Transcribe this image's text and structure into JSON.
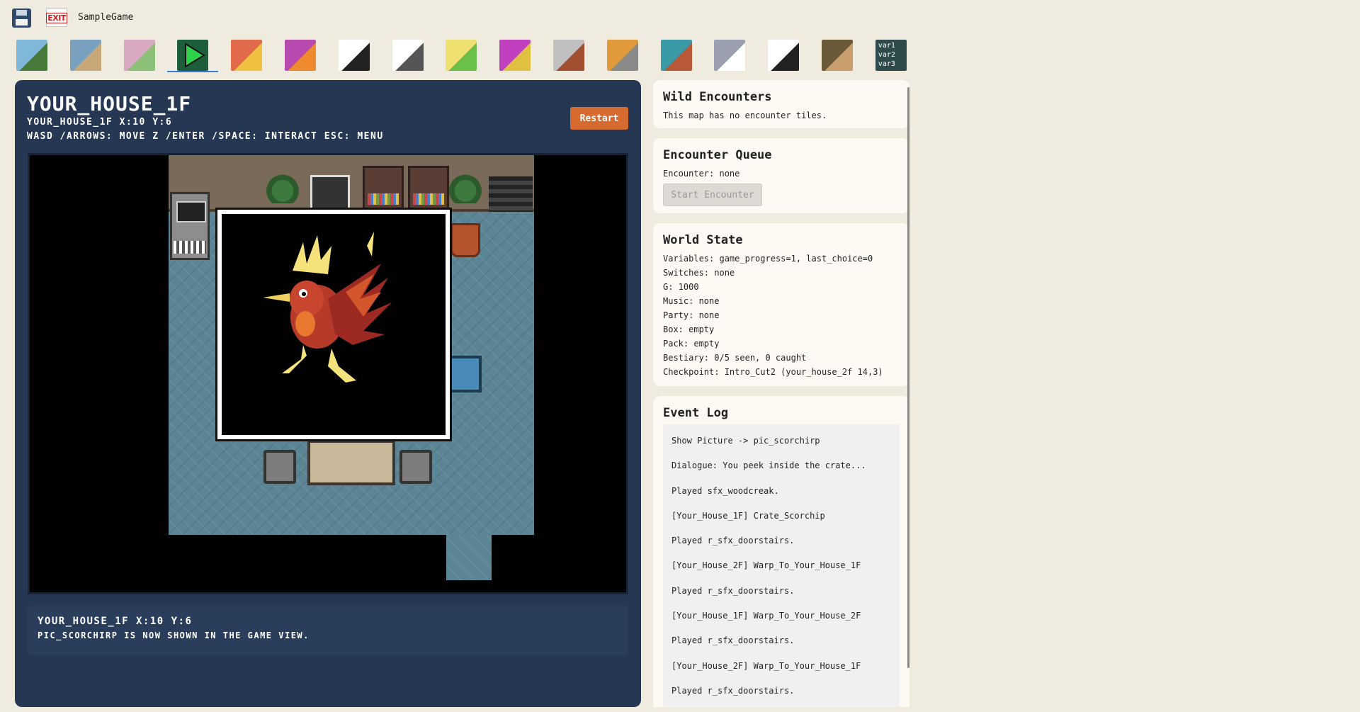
{
  "app": {
    "name": "SampleGame",
    "exit_label": "EXIT"
  },
  "toolbar": {
    "tools": [
      {
        "name": "map-editor-tool"
      },
      {
        "name": "tileset-tool"
      },
      {
        "name": "egg-tool"
      },
      {
        "name": "play-tool"
      },
      {
        "name": "battle-vs-tool"
      },
      {
        "name": "fire-skill-tool"
      },
      {
        "name": "movement-tool"
      },
      {
        "name": "dialogue-tool"
      },
      {
        "name": "potion-tool"
      },
      {
        "name": "creature-tool"
      },
      {
        "name": "characters-tool"
      },
      {
        "name": "settings-tools-tool"
      },
      {
        "name": "shop-tool"
      },
      {
        "name": "script-tool"
      },
      {
        "name": "music-tool"
      },
      {
        "name": "pictures-tool"
      },
      {
        "name": "variables-tool"
      }
    ],
    "active_index": 3,
    "variables_label": "var1 var2 var3"
  },
  "game": {
    "map_title": "YOUR_HOUSE_1F",
    "map_sub": "YOUR_HOUSE_1F   X:10   Y:6",
    "controls_help": "WASD /ARROWS: MOVE   Z /ENTER /SPACE: INTERACT   ESC: MENU",
    "restart_label": "Restart",
    "status_line1": "YOUR_HOUSE_1F   X:10   Y:6",
    "status_line2": "PIC_SCORCHIRP IS NOW SHOWN IN THE GAME VIEW."
  },
  "wild_encounters": {
    "title": "Wild Encounters",
    "text": "This map has no encounter tiles."
  },
  "encounter_queue": {
    "title": "Encounter Queue",
    "text": "Encounter: none",
    "button_label": "Start Encounter"
  },
  "world_state": {
    "title": "World State",
    "lines": [
      "Variables: game_progress=1, last_choice=0",
      "Switches: none",
      "G: 1000",
      "Music: none",
      "Party: none",
      "Box: empty",
      "Pack: empty",
      "Bestiary: 0/5 seen, 0 caught",
      "Checkpoint: Intro_Cut2 (your_house_2f 14,3)"
    ]
  },
  "event_log": {
    "title": "Event Log",
    "entries": [
      "Show Picture -> pic_scorchirp",
      "Dialogue: You peek inside the crate...",
      "Played sfx_woodcreak.",
      "[Your_House_1F] Crate_Scorchip",
      "Played r_sfx_doorstairs.",
      "[Your_House_2F] Warp_To_Your_House_1F",
      "Played r_sfx_doorstairs.",
      "[Your_House_1F] Warp_To_Your_House_2F",
      "Played r_sfx_doorstairs.",
      "[Your_House_2F] Warp_To_Your_House_1F",
      "Played r_sfx_doorstairs."
    ]
  },
  "colors": {
    "background": "#efebde",
    "game_panel": "#253753",
    "restart": "#d76b2f",
    "card": "#fcfaf2",
    "active_tool_underline": "#3a7bd5"
  }
}
